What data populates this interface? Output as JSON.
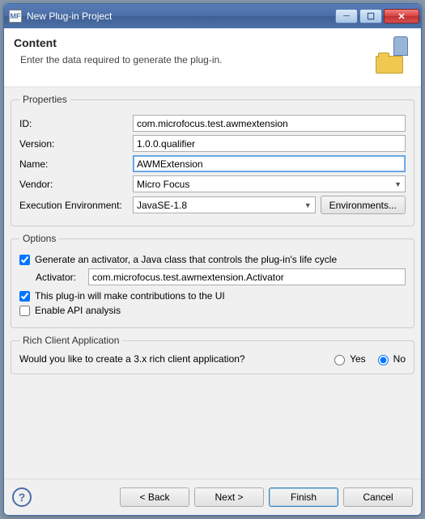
{
  "window": {
    "title": "New Plug-in Project"
  },
  "header": {
    "title": "Content",
    "subtitle": "Enter the data required to generate the plug-in."
  },
  "properties": {
    "legend": "Properties",
    "id_label": "ID:",
    "id_value": "com.microfocus.test.awmextension",
    "version_label": "Version:",
    "version_value": "1.0.0.qualifier",
    "name_label": "Name:",
    "name_value": "AWMExtension",
    "vendor_label": "Vendor:",
    "vendor_value": "Micro Focus",
    "env_label": "Execution Environment:",
    "env_value": "JavaSE-1.8",
    "env_button": "Environments..."
  },
  "options": {
    "legend": "Options",
    "generate_activator_label": "Generate an activator, a Java class that controls the plug-in's life cycle",
    "generate_activator_checked": true,
    "activator_label": "Activator:",
    "activator_value": "com.microfocus.test.awmextension.Activator",
    "contributions_label": "This plug-in will make contributions to the UI",
    "contributions_checked": true,
    "api_label": "Enable API analysis",
    "api_checked": false
  },
  "rich": {
    "legend": "Rich Client Application",
    "question": "Would you like to create a 3.x rich client application?",
    "yes_label": "Yes",
    "no_label": "No",
    "selected": "no"
  },
  "footer": {
    "back": "< Back",
    "next": "Next >",
    "finish": "Finish",
    "cancel": "Cancel"
  }
}
